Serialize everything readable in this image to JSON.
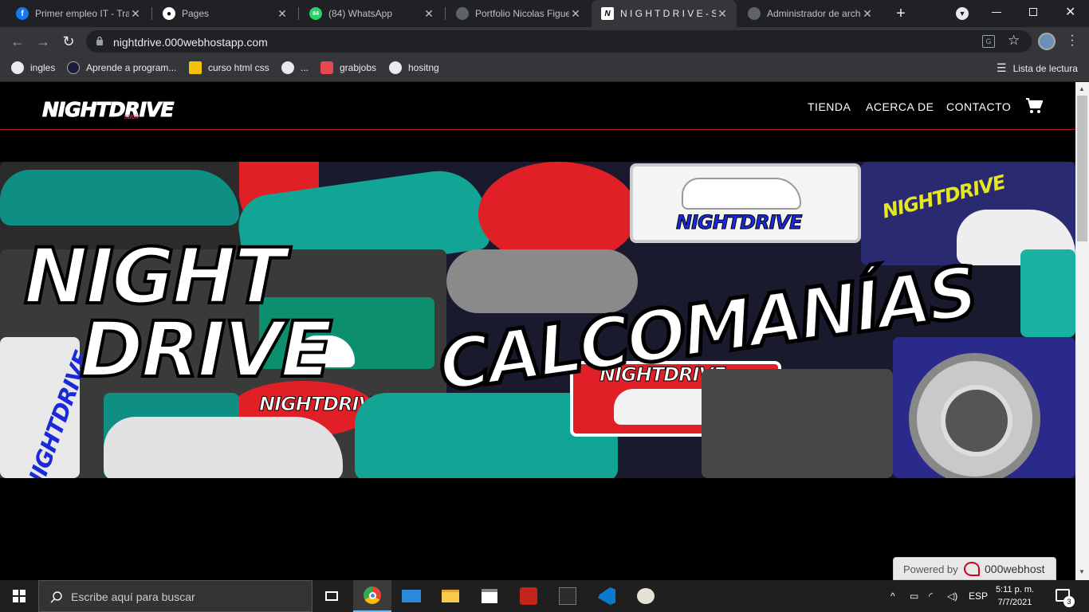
{
  "browser": {
    "tabs": [
      {
        "title": "Primer empleo IT - Trab",
        "icon": "facebook-icon",
        "color": "#1877f2"
      },
      {
        "title": "Pages",
        "icon": "github-icon",
        "color": "#ffffff"
      },
      {
        "title": "(84) WhatsApp",
        "icon": "whatsapp-icon",
        "color": "#25d366",
        "badge": "84"
      },
      {
        "title": "Portfolio Nicolas Figue",
        "icon": "globe-icon",
        "color": "#9aa0a6"
      },
      {
        "title": "N I G H T D R I V E - ST",
        "icon": "nightdrive-n-icon",
        "color": "#000000",
        "letter": "N"
      },
      {
        "title": "Administrador de arch",
        "icon": "globe-icon",
        "color": "#9aa0a6"
      }
    ],
    "url": "nightdrive.000webhostapp.com",
    "bookmarks": [
      {
        "label": "ingles",
        "icon": "play-icon"
      },
      {
        "label": "Aprende a program...",
        "icon": "code-icon"
      },
      {
        "label": "curso html css",
        "icon": "folder-icon"
      },
      {
        "label": "...",
        "icon": "globe-icon"
      },
      {
        "label": "grabjobs",
        "icon": "grabjobs-icon"
      },
      {
        "label": "hositng",
        "icon": "globe-icon"
      }
    ],
    "reading_list": "Lista de lectura"
  },
  "site": {
    "logo": "NIGHTDRIVE",
    "logo_sub": "stick",
    "nav": [
      "TIENDA",
      "ACERCA DE",
      "CONTACTO"
    ],
    "banner": {
      "left_line1": "NIGHT",
      "left_line2": "DRIVE",
      "main": "CALCOMANÍAS",
      "sticker_text": "NIGHTDRIVE"
    }
  },
  "powered": {
    "label": "Powered by",
    "brand": "000webhost"
  },
  "taskbar": {
    "search_placeholder": "Escribe aquí para buscar",
    "lang": "ESP",
    "time": "5:11 p. m.",
    "date": "7/7/2021",
    "notifications": "3"
  }
}
